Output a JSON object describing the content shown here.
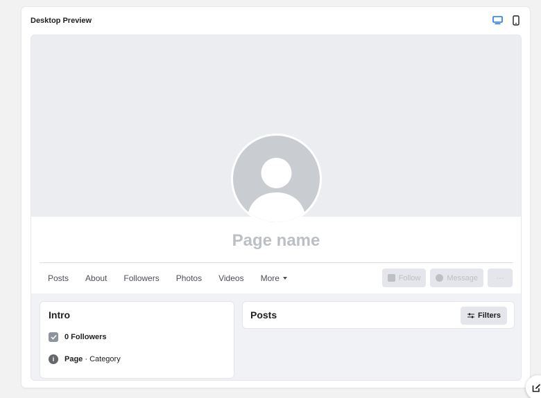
{
  "card": {
    "title": "Desktop Preview"
  },
  "device_toggle": [
    {
      "icon": "desktop-icon",
      "active": true,
      "color": "#1877f2"
    },
    {
      "icon": "mobile-icon",
      "active": false,
      "color": "#1c1e21"
    }
  ],
  "profile": {
    "page_name": "Page name"
  },
  "tabs": [
    "Posts",
    "About",
    "Followers",
    "Photos",
    "Videos",
    "More"
  ],
  "actions": {
    "follow": "Follow",
    "message": "Message",
    "more": "···"
  },
  "intro": {
    "title": "Intro",
    "followers": "0 Followers",
    "page_label": "Page",
    "page_category": " · Category"
  },
  "posts": {
    "title": "Posts",
    "filters_label": "Filters"
  },
  "colors": {
    "accent": "#1877f2",
    "disabled_text": "#bcc0c4"
  }
}
